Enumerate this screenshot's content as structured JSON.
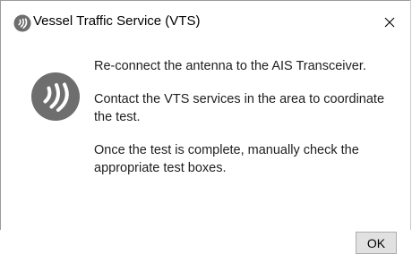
{
  "window": {
    "title": "Vessel Traffic Service (VTS)",
    "icon": "app-logo-icon",
    "close_icon": "close-icon"
  },
  "dialog": {
    "icon": "info-signal-icon",
    "messages": [
      "Re-connect the antenna to the AIS Transceiver.",
      "Contact the VTS services in the area to coordinate the test.",
      "Once the test is complete, manually check the appropriate test boxes."
    ],
    "ok_label": "OK"
  },
  "colors": {
    "icon_gray": "#6e6e6e",
    "button_bg": "#e1e1e1",
    "button_border": "#adadad"
  }
}
